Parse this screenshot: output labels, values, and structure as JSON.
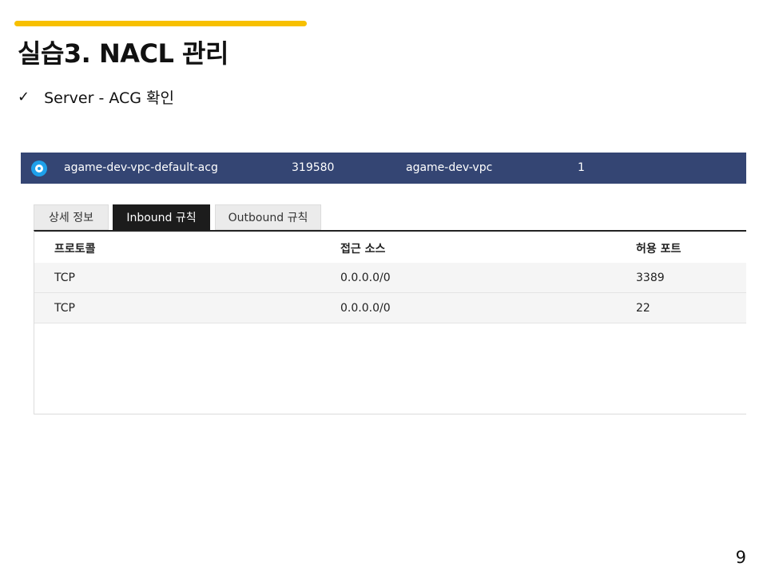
{
  "slide": {
    "title": "실습3. NACL 관리",
    "bullet": "Server - ACG 확인",
    "page_number": "9"
  },
  "acg_row": {
    "name": "agame-dev-vpc-default-acg",
    "id": "319580",
    "vpc": "agame-dev-vpc",
    "count": "1"
  },
  "tabs": [
    {
      "label": "상세 정보"
    },
    {
      "label": "Inbound 규칙"
    },
    {
      "label": "Outbound 규칙"
    }
  ],
  "rules": {
    "headers": [
      "프로토콜",
      "접근 소스",
      "허용 포트"
    ],
    "rows": [
      [
        "TCP",
        "0.0.0.0/0",
        "3389"
      ],
      [
        "TCP",
        "0.0.0.0/0",
        "22"
      ]
    ]
  },
  "colors": {
    "accent": "#f7c000",
    "row_selected": "#344573",
    "radio": "#1ea0ea",
    "tab_active": "#1c1c1c"
  }
}
